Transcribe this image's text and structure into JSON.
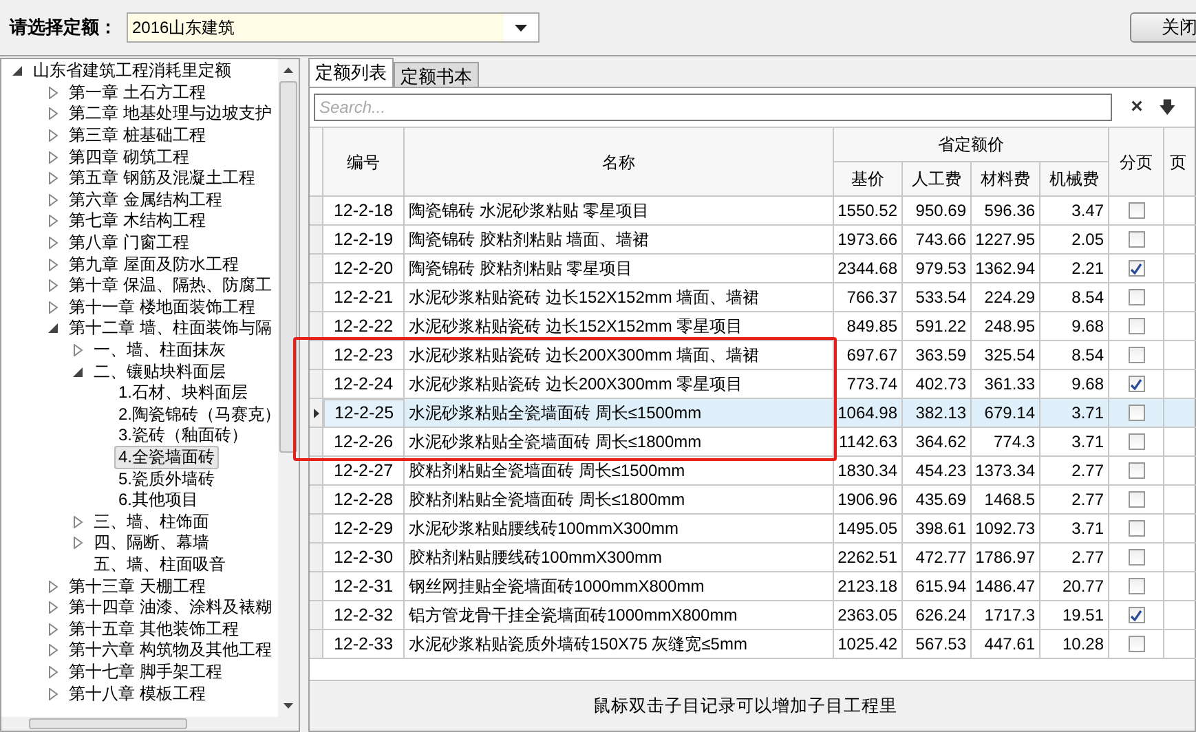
{
  "selector": {
    "label": "请选择定额：",
    "value": "2016山东建筑"
  },
  "close_button": "关闭",
  "tree": [
    {
      "label": "山东省建筑工程消耗里定额",
      "expanded": true,
      "selected": false,
      "children": [
        {
          "label": "第一章 土石方工程",
          "expanded": false,
          "selected": false
        },
        {
          "label": "第二章 地基处理与边坡支护",
          "expanded": false,
          "selected": false
        },
        {
          "label": "第三章 桩基础工程",
          "expanded": false,
          "selected": false
        },
        {
          "label": "第四章 砌筑工程",
          "expanded": false,
          "selected": false
        },
        {
          "label": "第五章 钢筋及混凝土工程",
          "expanded": false,
          "selected": false
        },
        {
          "label": "第六章 金属结构工程",
          "expanded": false,
          "selected": false
        },
        {
          "label": "第七章 木结构工程",
          "expanded": false,
          "selected": false
        },
        {
          "label": "第八章 门窗工程",
          "expanded": false,
          "selected": false
        },
        {
          "label": "第九章 屋面及防水工程",
          "expanded": false,
          "selected": false
        },
        {
          "label": "第十章 保温、隔热、防腐工",
          "expanded": false,
          "selected": false
        },
        {
          "label": "第十一章 楼地面装饰工程",
          "expanded": false,
          "selected": false
        },
        {
          "label": "第十二章 墙、柱面装饰与隔",
          "expanded": true,
          "selected": false,
          "children": [
            {
              "label": "一、墙、柱面抹灰",
              "expanded": false,
              "selected": false
            },
            {
              "label": "二、镶贴块料面层",
              "expanded": true,
              "selected": false,
              "children": [
                {
                  "label": "1.石材、块料面层",
                  "selected": false
                },
                {
                  "label": "2.陶瓷锦砖（马赛克）",
                  "selected": false
                },
                {
                  "label": "3.瓷砖（釉面砖）",
                  "selected": false
                },
                {
                  "label": "4.全瓷墙面砖",
                  "selected": true
                },
                {
                  "label": "5.瓷质外墙砖",
                  "selected": false
                },
                {
                  "label": "6.其他项目",
                  "selected": false
                }
              ]
            },
            {
              "label": "三、墙、柱饰面",
              "expanded": false,
              "selected": false
            },
            {
              "label": "四、隔断、幕墙",
              "expanded": false,
              "selected": false
            },
            {
              "label": "五、墙、柱面吸音",
              "selected": false
            }
          ]
        },
        {
          "label": "第十三章 天棚工程",
          "expanded": false,
          "selected": false
        },
        {
          "label": "第十四章 油漆、涂料及裱糊",
          "expanded": false,
          "selected": false
        },
        {
          "label": "第十五章 其他装饰工程",
          "expanded": false,
          "selected": false
        },
        {
          "label": "第十六章 构筑物及其他工程",
          "expanded": false,
          "selected": false
        },
        {
          "label": "第十七章 脚手架工程",
          "expanded": false,
          "selected": false
        },
        {
          "label": "第十八章 模板工程",
          "expanded": false,
          "selected": false
        }
      ]
    }
  ],
  "tabs": [
    {
      "label": "定额列表",
      "selected": true
    },
    {
      "label": "定额书本",
      "selected": false
    }
  ],
  "search": {
    "placeholder": "Search...",
    "clear": "×",
    "down": "🡇"
  },
  "table": {
    "columns": {
      "code": "编号",
      "name": "名称",
      "group": "省定额价",
      "base": "基价",
      "labor": "人工费",
      "material": "材料费",
      "machine": "机械费",
      "paging": "分页",
      "column_9": "页"
    },
    "rows": [
      {
        "code": "12-2-18",
        "name": "陶瓷锦砖 水泥砂浆粘贴 零星项目",
        "base": "1550.52",
        "labor": "950.69",
        "material": "596.36",
        "machine": "3.47",
        "checked": false,
        "selected": false,
        "marked": false
      },
      {
        "code": "12-2-19",
        "name": "陶瓷锦砖 胶粘剂粘贴 墙面、墙裙",
        "base": "1973.66",
        "labor": "743.66",
        "material": "1227.95",
        "machine": "2.05",
        "checked": false,
        "selected": false,
        "marked": false
      },
      {
        "code": "12-2-20",
        "name": "陶瓷锦砖 胶粘剂粘贴 零星项目",
        "base": "2344.68",
        "labor": "979.53",
        "material": "1362.94",
        "machine": "2.21",
        "checked": true,
        "selected": false,
        "marked": false
      },
      {
        "code": "12-2-21",
        "name": "水泥砂浆粘贴瓷砖 边长152X152mm 墙面、墙裙",
        "base": "766.37",
        "labor": "533.54",
        "material": "224.29",
        "machine": "8.54",
        "checked": false,
        "selected": false,
        "marked": false
      },
      {
        "code": "12-2-22",
        "name": "水泥砂浆粘贴瓷砖 边长152X152mm 零星项目",
        "base": "849.85",
        "labor": "591.22",
        "material": "248.95",
        "machine": "9.68",
        "checked": false,
        "selected": false,
        "marked": false
      },
      {
        "code": "12-2-23",
        "name": "水泥砂浆粘贴瓷砖 边长200X300mm 墙面、墙裙",
        "base": "697.67",
        "labor": "363.59",
        "material": "325.54",
        "machine": "8.54",
        "checked": false,
        "selected": false,
        "marked": true
      },
      {
        "code": "12-2-24",
        "name": "水泥砂浆粘贴瓷砖 边长200X300mm 零星项目",
        "base": "773.74",
        "labor": "402.73",
        "material": "361.33",
        "machine": "9.68",
        "checked": true,
        "selected": false,
        "marked": true
      },
      {
        "code": "12-2-25",
        "name": "水泥砂浆粘贴全瓷墙面砖 周长≤1500mm",
        "base": "1064.98",
        "labor": "382.13",
        "material": "679.14",
        "machine": "3.71",
        "checked": false,
        "selected": true,
        "marked": true
      },
      {
        "code": "12-2-26",
        "name": "水泥砂浆粘贴全瓷墙面砖 周长≤1800mm",
        "base": "1142.63",
        "labor": "364.62",
        "material": "774.3",
        "machine": "3.71",
        "checked": false,
        "selected": false,
        "marked": true
      },
      {
        "code": "12-2-27",
        "name": "胶粘剂粘贴全瓷墙面砖 周长≤1500mm",
        "base": "1830.34",
        "labor": "454.23",
        "material": "1373.34",
        "machine": "2.77",
        "checked": false,
        "selected": false,
        "marked": false
      },
      {
        "code": "12-2-28",
        "name": "胶粘剂粘贴全瓷墙面砖 周长≤1800mm",
        "base": "1906.96",
        "labor": "435.69",
        "material": "1468.5",
        "machine": "2.77",
        "checked": false,
        "selected": false,
        "marked": false
      },
      {
        "code": "12-2-29",
        "name": "水泥砂浆粘贴腰线砖100mmX300mm",
        "base": "1495.05",
        "labor": "398.61",
        "material": "1092.73",
        "machine": "3.71",
        "checked": false,
        "selected": false,
        "marked": false
      },
      {
        "code": "12-2-30",
        "name": "胶粘剂粘贴腰线砖100mmX300mm",
        "base": "2262.51",
        "labor": "472.77",
        "material": "1786.97",
        "machine": "2.77",
        "checked": false,
        "selected": false,
        "marked": false
      },
      {
        "code": "12-2-31",
        "name": "钢丝网挂贴全瓷墙面砖1000mmX800mm",
        "base": "2123.18",
        "labor": "615.94",
        "material": "1486.47",
        "machine": "20.77",
        "checked": false,
        "selected": false,
        "marked": false
      },
      {
        "code": "12-2-32",
        "name": "铝方管龙骨干挂全瓷墙面砖1000mmX800mm",
        "base": "2363.05",
        "labor": "626.24",
        "material": "1717.3",
        "machine": "19.51",
        "checked": true,
        "selected": false,
        "marked": false
      },
      {
        "code": "12-2-33",
        "name": "水泥砂浆粘贴瓷质外墙砖150X75 灰缝宽≤5mm",
        "base": "1025.42",
        "labor": "567.53",
        "material": "447.61",
        "machine": "10.28",
        "checked": false,
        "selected": false,
        "marked": false
      }
    ]
  },
  "hint": "鼠标双击子目记录可以增加子目工程里"
}
